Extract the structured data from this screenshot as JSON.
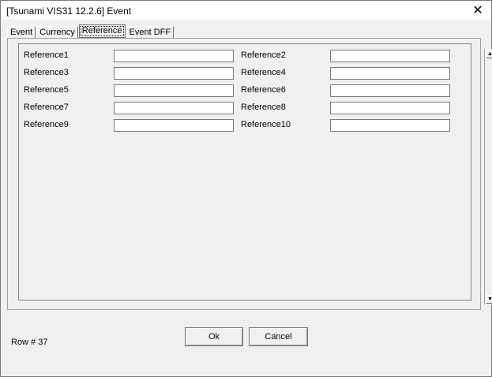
{
  "window": {
    "title": "[Tsunami VIS31 12.2.6] Event",
    "close_glyph": "✕"
  },
  "tabs": [
    {
      "label": "Event",
      "active": false
    },
    {
      "label": "Currency",
      "active": false
    },
    {
      "label": "Reference",
      "active": true
    },
    {
      "label": "Event DFF",
      "active": false
    }
  ],
  "references": [
    {
      "label": "Reference1",
      "value": ""
    },
    {
      "label": "Reference2",
      "value": ""
    },
    {
      "label": "Reference3",
      "value": ""
    },
    {
      "label": "Reference4",
      "value": ""
    },
    {
      "label": "Reference5",
      "value": ""
    },
    {
      "label": "Reference6",
      "value": ""
    },
    {
      "label": "Reference7",
      "value": ""
    },
    {
      "label": "Reference8",
      "value": ""
    },
    {
      "label": "Reference9",
      "value": ""
    },
    {
      "label": "Reference10",
      "value": ""
    }
  ],
  "scrollbar": {
    "up_glyph": "▲",
    "down_glyph": "▼"
  },
  "footer": {
    "row_count": "Row # 37",
    "ok_label": "Ok",
    "cancel_label": "Cancel"
  }
}
